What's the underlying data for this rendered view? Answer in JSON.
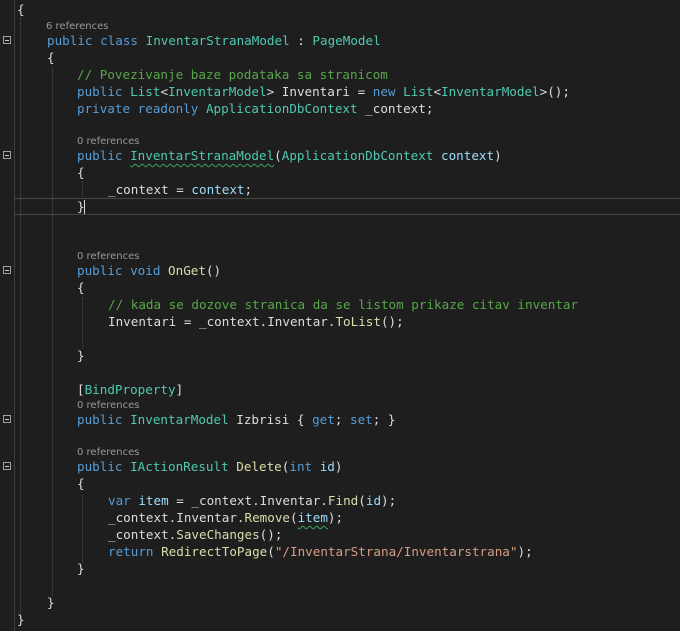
{
  "editor": {
    "lens": {
      "class_refs": "6 references",
      "ctor_refs": "0 references",
      "onget_refs": "0 references",
      "izbrisi_refs": "0 references",
      "delete_refs": "0 references"
    },
    "lines": [
      {
        "id": "l00",
        "parts": [
          {
            "c": "punc",
            "t": "{"
          }
        ]
      },
      {
        "id": "l01",
        "parts": [
          {
            "c": "kw",
            "t": "public"
          },
          {
            "c": "plain",
            "t": " "
          },
          {
            "c": "kw",
            "t": "class"
          },
          {
            "c": "plain",
            "t": " "
          },
          {
            "c": "ty",
            "t": "InventarStranaModel"
          },
          {
            "c": "plain",
            "t": " : "
          },
          {
            "c": "ty",
            "t": "PageModel"
          }
        ]
      },
      {
        "id": "l02",
        "parts": [
          {
            "c": "punc",
            "t": "{"
          }
        ]
      },
      {
        "id": "l03",
        "parts": [
          {
            "c": "cm",
            "t": "// Povezivanje baze podataka sa stranicom"
          }
        ]
      },
      {
        "id": "l04",
        "parts": [
          {
            "c": "kw",
            "t": "public"
          },
          {
            "c": "plain",
            "t": " "
          },
          {
            "c": "ty",
            "t": "List"
          },
          {
            "c": "plain",
            "t": "<"
          },
          {
            "c": "ty",
            "t": "InventarModel"
          },
          {
            "c": "plain",
            "t": "> Inventari = "
          },
          {
            "c": "kw",
            "t": "new"
          },
          {
            "c": "plain",
            "t": " "
          },
          {
            "c": "ty",
            "t": "List"
          },
          {
            "c": "plain",
            "t": "<"
          },
          {
            "c": "ty",
            "t": "InventarModel"
          },
          {
            "c": "plain",
            "t": ">();"
          }
        ]
      },
      {
        "id": "l05",
        "parts": [
          {
            "c": "kw",
            "t": "private"
          },
          {
            "c": "plain",
            "t": " "
          },
          {
            "c": "kw",
            "t": "readonly"
          },
          {
            "c": "plain",
            "t": " "
          },
          {
            "c": "ty",
            "t": "ApplicationDbContext"
          },
          {
            "c": "plain",
            "t": " _context;"
          }
        ]
      },
      {
        "id": "l06",
        "parts": [
          {
            "c": "kw",
            "t": "public"
          },
          {
            "c": "plain",
            "t": " "
          },
          {
            "c": "tysq",
            "t": "InventarStranaModel"
          },
          {
            "c": "plain",
            "t": "("
          },
          {
            "c": "ty",
            "t": "ApplicationDbContext"
          },
          {
            "c": "plain",
            "t": " "
          },
          {
            "c": "pm",
            "t": "context"
          },
          {
            "c": "plain",
            "t": ")"
          }
        ]
      },
      {
        "id": "l07",
        "parts": [
          {
            "c": "punc",
            "t": "{"
          }
        ]
      },
      {
        "id": "l08",
        "parts": [
          {
            "c": "plain",
            "t": "_context = "
          },
          {
            "c": "pm",
            "t": "context"
          },
          {
            "c": "plain",
            "t": ";"
          }
        ]
      },
      {
        "id": "l09",
        "parts": [
          {
            "c": "punc",
            "t": "}"
          }
        ]
      },
      {
        "id": "l10",
        "parts": [
          {
            "c": "kw",
            "t": "public"
          },
          {
            "c": "plain",
            "t": " "
          },
          {
            "c": "kw",
            "t": "void"
          },
          {
            "c": "plain",
            "t": " "
          },
          {
            "c": "fn",
            "t": "OnGet"
          },
          {
            "c": "plain",
            "t": "()"
          }
        ]
      },
      {
        "id": "l11",
        "parts": [
          {
            "c": "punc",
            "t": "{"
          }
        ]
      },
      {
        "id": "l12",
        "parts": [
          {
            "c": "cm",
            "t": "// kada se dozove stranica da se listom prikaze citav inventar"
          }
        ]
      },
      {
        "id": "l13",
        "parts": [
          {
            "c": "plain",
            "t": "Inventari = _context.Inventar."
          },
          {
            "c": "fn",
            "t": "ToList"
          },
          {
            "c": "plain",
            "t": "();"
          }
        ]
      },
      {
        "id": "l14",
        "parts": [
          {
            "c": "punc",
            "t": "}"
          }
        ]
      },
      {
        "id": "l15",
        "parts": [
          {
            "c": "plain",
            "t": "["
          },
          {
            "c": "at",
            "t": "BindProperty"
          },
          {
            "c": "plain",
            "t": "]"
          }
        ]
      },
      {
        "id": "l16",
        "parts": [
          {
            "c": "kw",
            "t": "public"
          },
          {
            "c": "plain",
            "t": " "
          },
          {
            "c": "ty",
            "t": "InventarModel"
          },
          {
            "c": "plain",
            "t": " Izbrisi { "
          },
          {
            "c": "kw",
            "t": "get"
          },
          {
            "c": "plain",
            "t": "; "
          },
          {
            "c": "kw",
            "t": "set"
          },
          {
            "c": "plain",
            "t": "; }"
          }
        ]
      },
      {
        "id": "l17",
        "parts": [
          {
            "c": "kw",
            "t": "public"
          },
          {
            "c": "plain",
            "t": " "
          },
          {
            "c": "ty",
            "t": "IActionResult"
          },
          {
            "c": "plain",
            "t": " "
          },
          {
            "c": "fn",
            "t": "Delete"
          },
          {
            "c": "plain",
            "t": "("
          },
          {
            "c": "kw",
            "t": "int"
          },
          {
            "c": "plain",
            "t": " "
          },
          {
            "c": "pm",
            "t": "id"
          },
          {
            "c": "plain",
            "t": ")"
          }
        ]
      },
      {
        "id": "l18",
        "parts": [
          {
            "c": "punc",
            "t": "{"
          }
        ]
      },
      {
        "id": "l19",
        "parts": [
          {
            "c": "kw",
            "t": "var"
          },
          {
            "c": "plain",
            "t": " "
          },
          {
            "c": "pm",
            "t": "item"
          },
          {
            "c": "plain",
            "t": " = _context.Inventar."
          },
          {
            "c": "fn",
            "t": "Find"
          },
          {
            "c": "plain",
            "t": "("
          },
          {
            "c": "pm",
            "t": "id"
          },
          {
            "c": "plain",
            "t": ");"
          }
        ]
      },
      {
        "id": "l20",
        "parts": [
          {
            "c": "plain",
            "t": "_context.Inventar."
          },
          {
            "c": "fn",
            "t": "Remove"
          },
          {
            "c": "plain",
            "t": "("
          },
          {
            "c": "pmsq",
            "t": "item"
          },
          {
            "c": "plain",
            "t": ");"
          }
        ]
      },
      {
        "id": "l21",
        "parts": [
          {
            "c": "plain",
            "t": "_context."
          },
          {
            "c": "fn",
            "t": "SaveChanges"
          },
          {
            "c": "plain",
            "t": "();"
          }
        ]
      },
      {
        "id": "l22",
        "parts": [
          {
            "c": "kw",
            "t": "return"
          },
          {
            "c": "plain",
            "t": " "
          },
          {
            "c": "fn",
            "t": "RedirectToPage"
          },
          {
            "c": "plain",
            "t": "("
          },
          {
            "c": "st",
            "t": "\"/InventarStrana/Inventarstrana\""
          },
          {
            "c": "plain",
            "t": ");"
          }
        ]
      },
      {
        "id": "l23",
        "parts": [
          {
            "c": "punc",
            "t": "}"
          }
        ]
      },
      {
        "id": "l24",
        "parts": [
          {
            "c": "punc",
            "t": "}"
          }
        ]
      },
      {
        "id": "l25",
        "parts": [
          {
            "c": "punc",
            "t": "}"
          }
        ]
      }
    ],
    "colors": {
      "background": "#1e1e1e",
      "keyword": "#569cd6",
      "type": "#4ec9b0",
      "comment": "#57a64a",
      "method": "#dcdcaa",
      "parameter": "#9cdcfe",
      "string": "#d69d85",
      "text": "#dcdcdc"
    }
  }
}
